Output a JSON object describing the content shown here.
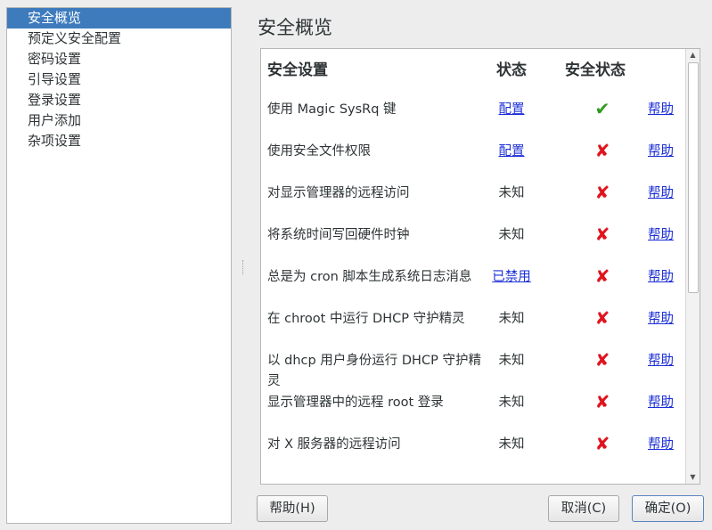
{
  "sidebar": {
    "items": [
      {
        "label": "安全概览",
        "selected": true
      },
      {
        "label": "预定义安全配置",
        "selected": false
      },
      {
        "label": "密码设置",
        "selected": false
      },
      {
        "label": "引导设置",
        "selected": false
      },
      {
        "label": "登录设置",
        "selected": false
      },
      {
        "label": "用户添加",
        "selected": false
      },
      {
        "label": "杂项设置",
        "selected": false
      }
    ]
  },
  "main": {
    "title": "安全概览",
    "table": {
      "headers": {
        "setting": "安全设置",
        "status": "状态",
        "security": "安全状态"
      },
      "rows": [
        {
          "name": "使用 Magic SysRq 键",
          "status": "配置",
          "status_link": true,
          "secure": true,
          "help": "帮助"
        },
        {
          "name": "使用安全文件权限",
          "status": "配置",
          "status_link": true,
          "secure": false,
          "help": "帮助"
        },
        {
          "name": "对显示管理器的远程访问",
          "status": "未知",
          "status_link": false,
          "secure": false,
          "help": "帮助"
        },
        {
          "name": "将系统时间写回硬件时钟",
          "status": "未知",
          "status_link": false,
          "secure": false,
          "help": "帮助"
        },
        {
          "name": "总是为 cron 脚本生成系统日志消息",
          "status": "已禁用",
          "status_link": true,
          "secure": false,
          "help": "帮助"
        },
        {
          "name": "在 chroot 中运行 DHCP 守护精灵",
          "status": "未知",
          "status_link": false,
          "secure": false,
          "help": "帮助"
        },
        {
          "name": "以 dhcp 用户身份运行 DHCP 守护精灵",
          "status": "未知",
          "status_link": false,
          "secure": false,
          "help": "帮助"
        },
        {
          "name": "显示管理器中的远程 root 登录",
          "status": "未知",
          "status_link": false,
          "secure": false,
          "help": "帮助"
        },
        {
          "name": "对 X 服务器的远程访问",
          "status": "未知",
          "status_link": false,
          "secure": false,
          "help": "帮助"
        }
      ]
    },
    "status_icons": {
      "secure": "check-icon",
      "insecure": "cross-icon"
    },
    "colors": {
      "secure": "#2f9a1e",
      "insecure": "#e0141e",
      "link": "#1a2dd6",
      "selection": "#3d7bbd"
    }
  },
  "buttons": {
    "help": "帮助(H)",
    "cancel": "取消(C)",
    "ok": "确定(O)"
  }
}
